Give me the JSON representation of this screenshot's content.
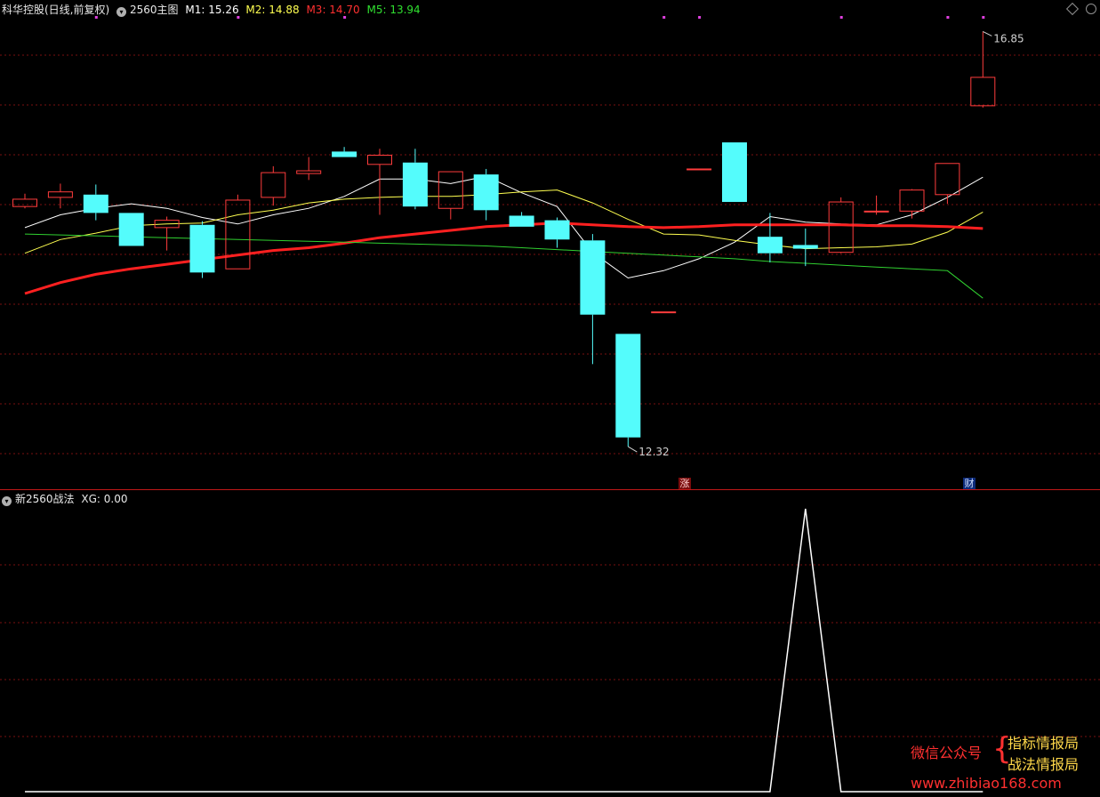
{
  "main_panel": {
    "title": "科华控股(日线,前复权)",
    "indicator": "2560主图",
    "legend": [
      {
        "label": "M1: 15.26",
        "color": "#ffffff"
      },
      {
        "label": "M2: 14.88",
        "color": "#ffff50"
      },
      {
        "label": "M3: 14.70",
        "color": "#ff3030"
      },
      {
        "label": "M5: 13.94",
        "color": "#30e030"
      }
    ],
    "high_label": "16.85",
    "low_label": "12.32",
    "marker_zhang": "涨",
    "marker_cai": "财"
  },
  "sub_panel": {
    "indicator": "新2560战法",
    "readout": "XG: 0.00"
  },
  "watermark": {
    "prefix": "微信公众号",
    "line1": "指标情报局",
    "line2": "战法情报局",
    "url": "www.zhibiao168.com"
  },
  "colors": {
    "up": "#ff3c3c",
    "down": "#54fcfc",
    "m1": "#ffffff",
    "m2": "#ffff50",
    "m3": "#ff2020",
    "m5": "#30d030",
    "grid": "#7a1010",
    "separator": "#c01818",
    "signal": "#ffffff"
  },
  "chart_data": [
    {
      "type": "candlestick",
      "y_range": [
        12.0,
        17.0
      ],
      "candles": [
        {
          "o": 14.94,
          "c": 15.02,
          "h": 15.08,
          "l": 14.92
        },
        {
          "o": 15.04,
          "c": 15.1,
          "h": 15.19,
          "l": 14.92
        },
        {
          "o": 15.07,
          "c": 14.87,
          "h": 15.18,
          "l": 14.79
        },
        {
          "o": 14.87,
          "c": 14.51,
          "h": 14.87,
          "l": 14.51
        },
        {
          "o": 14.71,
          "c": 14.79,
          "h": 14.83,
          "l": 14.46
        },
        {
          "o": 14.74,
          "c": 14.22,
          "h": 14.78,
          "l": 14.16
        },
        {
          "o": 14.26,
          "c": 15.01,
          "h": 15.07,
          "l": 14.26
        },
        {
          "o": 15.04,
          "c": 15.31,
          "h": 15.38,
          "l": 14.95
        },
        {
          "o": 15.3,
          "c": 15.33,
          "h": 15.48,
          "l": 15.23
        },
        {
          "o": 15.54,
          "c": 15.48,
          "h": 15.59,
          "l": 15.48
        },
        {
          "o": 15.4,
          "c": 15.5,
          "h": 15.57,
          "l": 14.85
        },
        {
          "o": 15.42,
          "c": 14.94,
          "h": 15.57,
          "l": 14.91
        },
        {
          "o": 14.92,
          "c": 15.32,
          "h": 15.32,
          "l": 14.8
        },
        {
          "o": 15.29,
          "c": 14.9,
          "h": 15.35,
          "l": 14.79
        },
        {
          "o": 14.84,
          "c": 14.72,
          "h": 14.88,
          "l": 14.72
        },
        {
          "o": 14.79,
          "c": 14.58,
          "h": 14.82,
          "l": 14.49
        },
        {
          "o": 14.57,
          "c": 13.76,
          "h": 14.64,
          "l": 13.22
        },
        {
          "o": 13.55,
          "c": 12.42,
          "h": 13.55,
          "l": 12.32
        },
        {
          "o": 13.79,
          "c": 13.79,
          "h": 13.79,
          "l": 13.79
        },
        {
          "o": 15.35,
          "c": 15.35,
          "h": 15.35,
          "l": 15.35
        },
        {
          "o": 15.64,
          "c": 14.99,
          "h": 15.64,
          "l": 14.99
        },
        {
          "o": 14.61,
          "c": 14.43,
          "h": 14.87,
          "l": 14.33
        },
        {
          "o": 14.52,
          "c": 14.48,
          "h": 14.7,
          "l": 14.29
        },
        {
          "o": 14.44,
          "c": 14.99,
          "h": 15.04,
          "l": 14.43
        },
        {
          "o": 14.89,
          "c": 14.89,
          "h": 15.06,
          "l": 14.85
        },
        {
          "o": 14.89,
          "c": 15.12,
          "h": 15.13,
          "l": 14.81
        },
        {
          "o": 15.07,
          "c": 15.41,
          "h": 15.41,
          "l": 14.97
        },
        {
          "o": 16.04,
          "c": 16.35,
          "h": 16.85,
          "l": 16.02
        }
      ],
      "series": [
        {
          "name": "M1",
          "values": [
            14.71,
            14.85,
            14.92,
            14.97,
            14.92,
            14.82,
            14.75,
            14.85,
            14.92,
            15.05,
            15.24,
            15.24,
            15.19,
            15.27,
            15.09,
            14.94,
            14.44,
            14.16,
            14.24,
            14.37,
            14.55,
            14.83,
            14.77,
            14.75,
            14.74,
            14.85,
            15.04,
            15.26
          ]
        },
        {
          "name": "M2",
          "values": [
            14.43,
            14.58,
            14.65,
            14.73,
            14.75,
            14.76,
            14.85,
            14.9,
            14.98,
            15.02,
            15.04,
            15.05,
            15.05,
            15.07,
            15.1,
            15.12,
            14.98,
            14.8,
            14.64,
            14.63,
            14.57,
            14.52,
            14.48,
            14.49,
            14.5,
            14.53,
            14.66,
            14.88
          ]
        },
        {
          "name": "M3",
          "values": [
            13.99,
            14.11,
            14.2,
            14.26,
            14.31,
            14.36,
            14.41,
            14.46,
            14.49,
            14.54,
            14.6,
            14.64,
            14.68,
            14.72,
            14.74,
            14.76,
            14.74,
            14.72,
            14.71,
            14.72,
            14.74,
            14.74,
            14.74,
            14.74,
            14.73,
            14.73,
            14.72,
            14.7
          ]
        },
        {
          "name": "M5",
          "values": [
            14.64,
            14.63,
            14.62,
            14.61,
            14.6,
            14.59,
            14.58,
            14.57,
            14.56,
            14.55,
            14.54,
            14.53,
            14.52,
            14.51,
            14.49,
            14.47,
            14.45,
            14.43,
            14.41,
            14.39,
            14.37,
            14.34,
            14.32,
            14.3,
            14.28,
            14.26,
            14.24,
            13.94
          ]
        }
      ],
      "top_dots": [
        2,
        6,
        9,
        18,
        19,
        23,
        26,
        27
      ]
    },
    {
      "type": "line",
      "name": "XG",
      "y_range": [
        0,
        1
      ],
      "values": [
        0,
        0,
        0,
        0,
        0,
        0,
        0,
        0,
        0,
        0,
        0,
        0,
        0,
        0,
        0,
        0,
        0,
        0,
        0,
        0,
        0,
        0,
        1,
        0,
        0,
        0,
        0,
        0
      ]
    }
  ]
}
